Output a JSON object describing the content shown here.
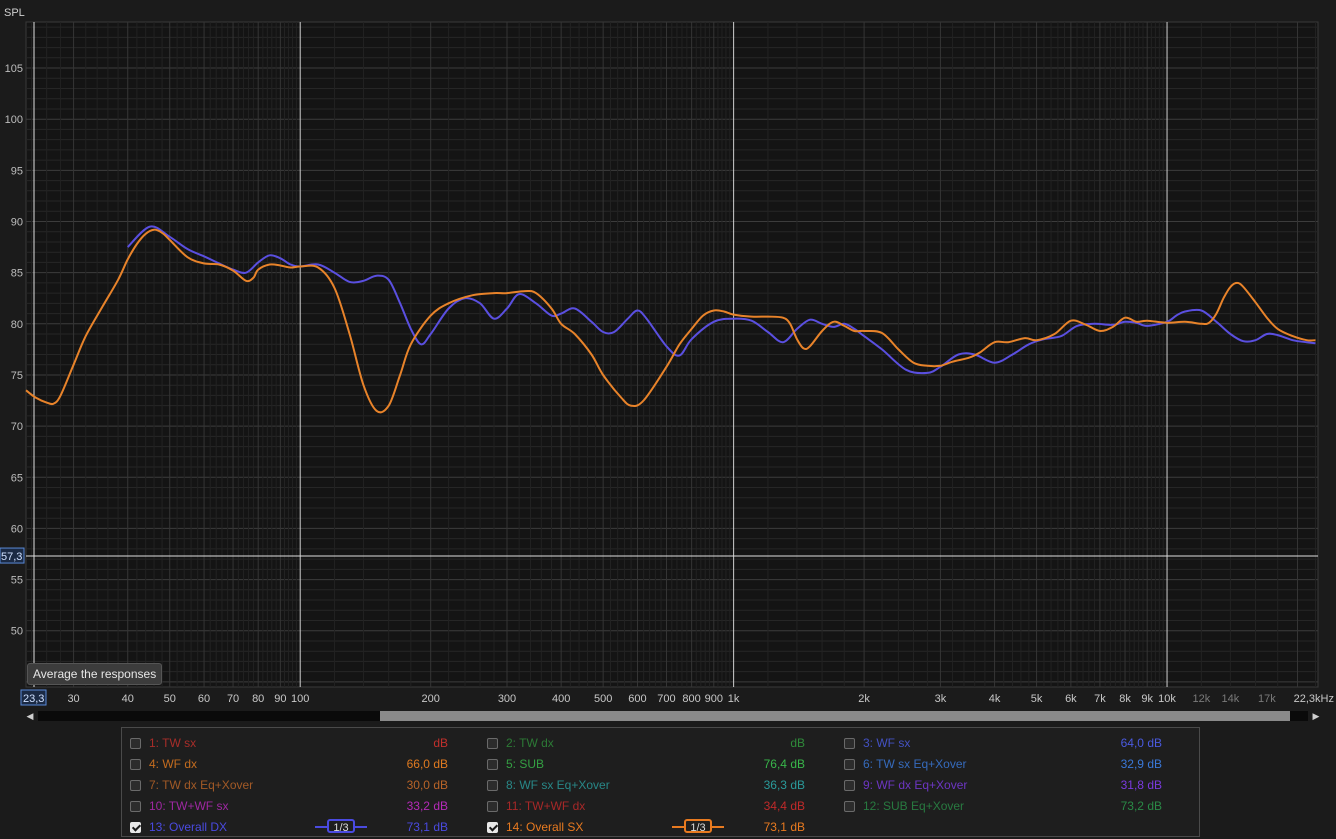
{
  "axis": {
    "y_label": "SPL",
    "x_unit": "Hz",
    "x_range_hz": [
      23.3,
      22300
    ],
    "y_range_db": [
      44.5,
      109.5
    ],
    "y_ticks": [
      105,
      100,
      95,
      90,
      85,
      80,
      75,
      70,
      65,
      60,
      55,
      50
    ],
    "x_ticks": [
      {
        "f": 30,
        "label": "30"
      },
      {
        "f": 40,
        "label": "40"
      },
      {
        "f": 50,
        "label": "50"
      },
      {
        "f": 60,
        "label": "60"
      },
      {
        "f": 70,
        "label": "70"
      },
      {
        "f": 80,
        "label": "80"
      },
      {
        "f": 90,
        "label": "90"
      },
      {
        "f": 100,
        "label": "100"
      },
      {
        "f": 200,
        "label": "200"
      },
      {
        "f": 300,
        "label": "300"
      },
      {
        "f": 400,
        "label": "400"
      },
      {
        "f": 500,
        "label": "500"
      },
      {
        "f": 600,
        "label": "600"
      },
      {
        "f": 700,
        "label": "700"
      },
      {
        "f": 800,
        "label": "800"
      },
      {
        "f": 900,
        "label": "900"
      },
      {
        "f": 1000,
        "label": "1k"
      },
      {
        "f": 2000,
        "label": "2k"
      },
      {
        "f": 3000,
        "label": "3k"
      },
      {
        "f": 4000,
        "label": "4k"
      },
      {
        "f": 5000,
        "label": "5k"
      },
      {
        "f": 6000,
        "label": "6k"
      },
      {
        "f": 7000,
        "label": "7k"
      },
      {
        "f": 8000,
        "label": "8k"
      },
      {
        "f": 9000,
        "label": "9k"
      },
      {
        "f": 10000,
        "label": "10k"
      },
      {
        "f": 12000,
        "label": "12k",
        "dim": true
      },
      {
        "f": 14000,
        "label": "14k",
        "dim": true
      },
      {
        "f": 17000,
        "label": "17k",
        "dim": true
      },
      {
        "f": 22300,
        "label": "22,3kHz"
      }
    ],
    "cursor_x_label": "23,3",
    "cursor_y_label": "57,3",
    "cursor_y_db": 57.3
  },
  "tooltip": "Average the responses",
  "chart_data": {
    "type": "line",
    "title": "",
    "xlabel": "Hz",
    "ylabel": "SPL",
    "xscale": "log",
    "xlim": [
      23.3,
      22300
    ],
    "ylim": [
      44.5,
      109.5
    ],
    "grid": true,
    "series": [
      {
        "name": "13: Overall DX",
        "color": "#5a4fe0",
        "points": [
          [
            40,
            87.5
          ],
          [
            45,
            89.5
          ],
          [
            50,
            88.5
          ],
          [
            55,
            87.3
          ],
          [
            60,
            86.6
          ],
          [
            65,
            85.9
          ],
          [
            70,
            85.3
          ],
          [
            75,
            85.0
          ],
          [
            80,
            86.0
          ],
          [
            85,
            86.7
          ],
          [
            90,
            86.4
          ],
          [
            95,
            85.8
          ],
          [
            100,
            85.6
          ],
          [
            110,
            85.8
          ],
          [
            120,
            85.0
          ],
          [
            130,
            84.1
          ],
          [
            140,
            84.2
          ],
          [
            150,
            84.7
          ],
          [
            160,
            84.3
          ],
          [
            170,
            82.0
          ],
          [
            180,
            79.5
          ],
          [
            190,
            78.0
          ],
          [
            200,
            79.0
          ],
          [
            220,
            81.5
          ],
          [
            240,
            82.5
          ],
          [
            260,
            82.0
          ],
          [
            280,
            80.5
          ],
          [
            300,
            81.5
          ],
          [
            320,
            82.9
          ],
          [
            350,
            82.0
          ],
          [
            380,
            80.8
          ],
          [
            400,
            81.0
          ],
          [
            430,
            81.5
          ],
          [
            470,
            80.2
          ],
          [
            500,
            79.2
          ],
          [
            530,
            79.2
          ],
          [
            570,
            80.5
          ],
          [
            600,
            81.3
          ],
          [
            630,
            80.5
          ],
          [
            700,
            77.8
          ],
          [
            750,
            76.9
          ],
          [
            800,
            78.5
          ],
          [
            900,
            80.2
          ],
          [
            1000,
            80.5
          ],
          [
            1100,
            80.3
          ],
          [
            1200,
            79.2
          ],
          [
            1300,
            78.2
          ],
          [
            1400,
            79.5
          ],
          [
            1500,
            80.4
          ],
          [
            1600,
            80.0
          ],
          [
            1700,
            79.7
          ],
          [
            1800,
            80.0
          ],
          [
            1900,
            79.5
          ],
          [
            2000,
            78.8
          ],
          [
            2200,
            77.5
          ],
          [
            2500,
            75.5
          ],
          [
            2800,
            75.2
          ],
          [
            3000,
            75.8
          ],
          [
            3300,
            77.0
          ],
          [
            3600,
            77.0
          ],
          [
            4000,
            76.2
          ],
          [
            4400,
            77.0
          ],
          [
            4800,
            78.0
          ],
          [
            5200,
            78.5
          ],
          [
            5700,
            78.8
          ],
          [
            6200,
            79.8
          ],
          [
            6800,
            80.0
          ],
          [
            7500,
            79.9
          ],
          [
            8000,
            80.2
          ],
          [
            8500,
            80.1
          ],
          [
            9000,
            79.8
          ],
          [
            10000,
            80.2
          ],
          [
            10500,
            80.8
          ],
          [
            11000,
            81.2
          ],
          [
            12000,
            81.3
          ],
          [
            13000,
            80.2
          ],
          [
            14000,
            79.0
          ],
          [
            15000,
            78.3
          ],
          [
            16000,
            78.4
          ],
          [
            17000,
            79.0
          ],
          [
            18000,
            78.9
          ],
          [
            19500,
            78.4
          ],
          [
            21000,
            78.2
          ],
          [
            22000,
            78.1
          ]
        ],
        "level": "73,1 dB",
        "smoothing": "1/3"
      },
      {
        "name": "14: Overall SX",
        "color": "#e8832a",
        "points": [
          [
            23.3,
            73.5
          ],
          [
            24.5,
            72.8
          ],
          [
            26,
            72.3
          ],
          [
            27,
            72.2
          ],
          [
            28,
            73.0
          ],
          [
            30,
            76.0
          ],
          [
            32,
            78.8
          ],
          [
            35,
            81.7
          ],
          [
            38,
            84.3
          ],
          [
            40,
            86.3
          ],
          [
            42,
            87.8
          ],
          [
            44,
            88.8
          ],
          [
            46,
            89.2
          ],
          [
            48,
            88.9
          ],
          [
            50,
            88.2
          ],
          [
            55,
            86.5
          ],
          [
            60,
            85.9
          ],
          [
            65,
            85.8
          ],
          [
            70,
            85.2
          ],
          [
            75,
            84.2
          ],
          [
            78,
            84.5
          ],
          [
            80,
            85.3
          ],
          [
            85,
            85.8
          ],
          [
            90,
            85.7
          ],
          [
            95,
            85.5
          ],
          [
            100,
            85.6
          ],
          [
            110,
            85.5
          ],
          [
            120,
            83.5
          ],
          [
            130,
            79.0
          ],
          [
            140,
            74.0
          ],
          [
            150,
            71.5
          ],
          [
            160,
            72.0
          ],
          [
            170,
            75.0
          ],
          [
            180,
            78.0
          ],
          [
            200,
            80.8
          ],
          [
            220,
            82.0
          ],
          [
            250,
            82.8
          ],
          [
            280,
            83.0
          ],
          [
            300,
            83.0
          ],
          [
            330,
            83.2
          ],
          [
            350,
            83.0
          ],
          [
            380,
            81.5
          ],
          [
            400,
            80.0
          ],
          [
            430,
            79.0
          ],
          [
            470,
            77.0
          ],
          [
            500,
            75.0
          ],
          [
            550,
            72.8
          ],
          [
            580,
            72.0
          ],
          [
            620,
            72.5
          ],
          [
            700,
            75.8
          ],
          [
            750,
            78.0
          ],
          [
            800,
            79.5
          ],
          [
            850,
            80.8
          ],
          [
            900,
            81.3
          ],
          [
            950,
            81.2
          ],
          [
            1000,
            80.9
          ],
          [
            1100,
            80.7
          ],
          [
            1200,
            80.7
          ],
          [
            1300,
            80.6
          ],
          [
            1350,
            80.0
          ],
          [
            1400,
            78.5
          ],
          [
            1450,
            77.6
          ],
          [
            1500,
            77.8
          ],
          [
            1600,
            79.3
          ],
          [
            1700,
            80.2
          ],
          [
            1800,
            79.8
          ],
          [
            1900,
            79.3
          ],
          [
            2000,
            79.3
          ],
          [
            2200,
            79.1
          ],
          [
            2400,
            77.5
          ],
          [
            2600,
            76.2
          ],
          [
            2800,
            75.9
          ],
          [
            3000,
            75.9
          ],
          [
            3200,
            76.3
          ],
          [
            3500,
            76.7
          ],
          [
            3700,
            77.2
          ],
          [
            4000,
            78.2
          ],
          [
            4300,
            78.2
          ],
          [
            4700,
            78.6
          ],
          [
            5000,
            78.4
          ],
          [
            5500,
            79.0
          ],
          [
            6000,
            80.3
          ],
          [
            6500,
            79.9
          ],
          [
            7000,
            79.3
          ],
          [
            7500,
            79.7
          ],
          [
            8000,
            80.6
          ],
          [
            8500,
            80.2
          ],
          [
            9000,
            80.3
          ],
          [
            10000,
            80.1
          ],
          [
            11000,
            80.2
          ],
          [
            12000,
            80.0
          ],
          [
            12500,
            80.1
          ],
          [
            13000,
            81.0
          ],
          [
            13500,
            82.5
          ],
          [
            14000,
            83.6
          ],
          [
            14500,
            84.0
          ],
          [
            15000,
            83.6
          ],
          [
            16000,
            82.1
          ],
          [
            17000,
            80.6
          ],
          [
            18000,
            79.5
          ],
          [
            19500,
            78.8
          ],
          [
            21000,
            78.4
          ],
          [
            22000,
            78.4
          ]
        ],
        "level": "73,1 dB",
        "smoothing": "1/3"
      }
    ]
  },
  "legend": [
    {
      "label": "1: TW sx",
      "value": "dB",
      "color": "#c0302c",
      "checked": false
    },
    {
      "label": "2: TW dx",
      "value": "dB",
      "color": "#2f8a3a",
      "checked": false
    },
    {
      "label": "3: WF sx",
      "value": "64,0 dB",
      "color": "#4a5ae0",
      "checked": false
    },
    {
      "label": "4: WF dx",
      "value": "66,0 dB",
      "color": "#e07a20",
      "checked": false
    },
    {
      "label": "5: SUB",
      "value": "76,4 dB",
      "color": "#38b64a",
      "checked": false
    },
    {
      "label": "6: TW sx Eq+Xover",
      "value": "32,9 dB",
      "color": "#3a78d8",
      "checked": false
    },
    {
      "label": "7: TW dx Eq+Xover",
      "value": "30,0 dB",
      "color": "#b86428",
      "checked": false
    },
    {
      "label": "8: WF sx Eq+Xover",
      "value": "36,3 dB",
      "color": "#2a9a9a",
      "checked": false
    },
    {
      "label": "9: WF dx Eq+Xover",
      "value": "31,8 dB",
      "color": "#7a3adf",
      "checked": false
    },
    {
      "label": "10: TW+WF sx",
      "value": "33,2 dB",
      "color": "#b42ab8",
      "checked": false
    },
    {
      "label": "11: TW+WF dx",
      "value": "34,4 dB",
      "color": "#c02a2a",
      "checked": false
    },
    {
      "label": "12: SUB Eq+Xover",
      "value": "73,2 dB",
      "color": "#2a8a46",
      "checked": false
    },
    {
      "label": "13: Overall DX",
      "value": "73,1 dB",
      "color": "#4a4ae0",
      "checked": true,
      "smoothing": "1/3"
    },
    {
      "label": "14: Overall SX",
      "value": "73,1 dB",
      "color": "#e87a20",
      "checked": true,
      "smoothing": "1/3"
    }
  ]
}
